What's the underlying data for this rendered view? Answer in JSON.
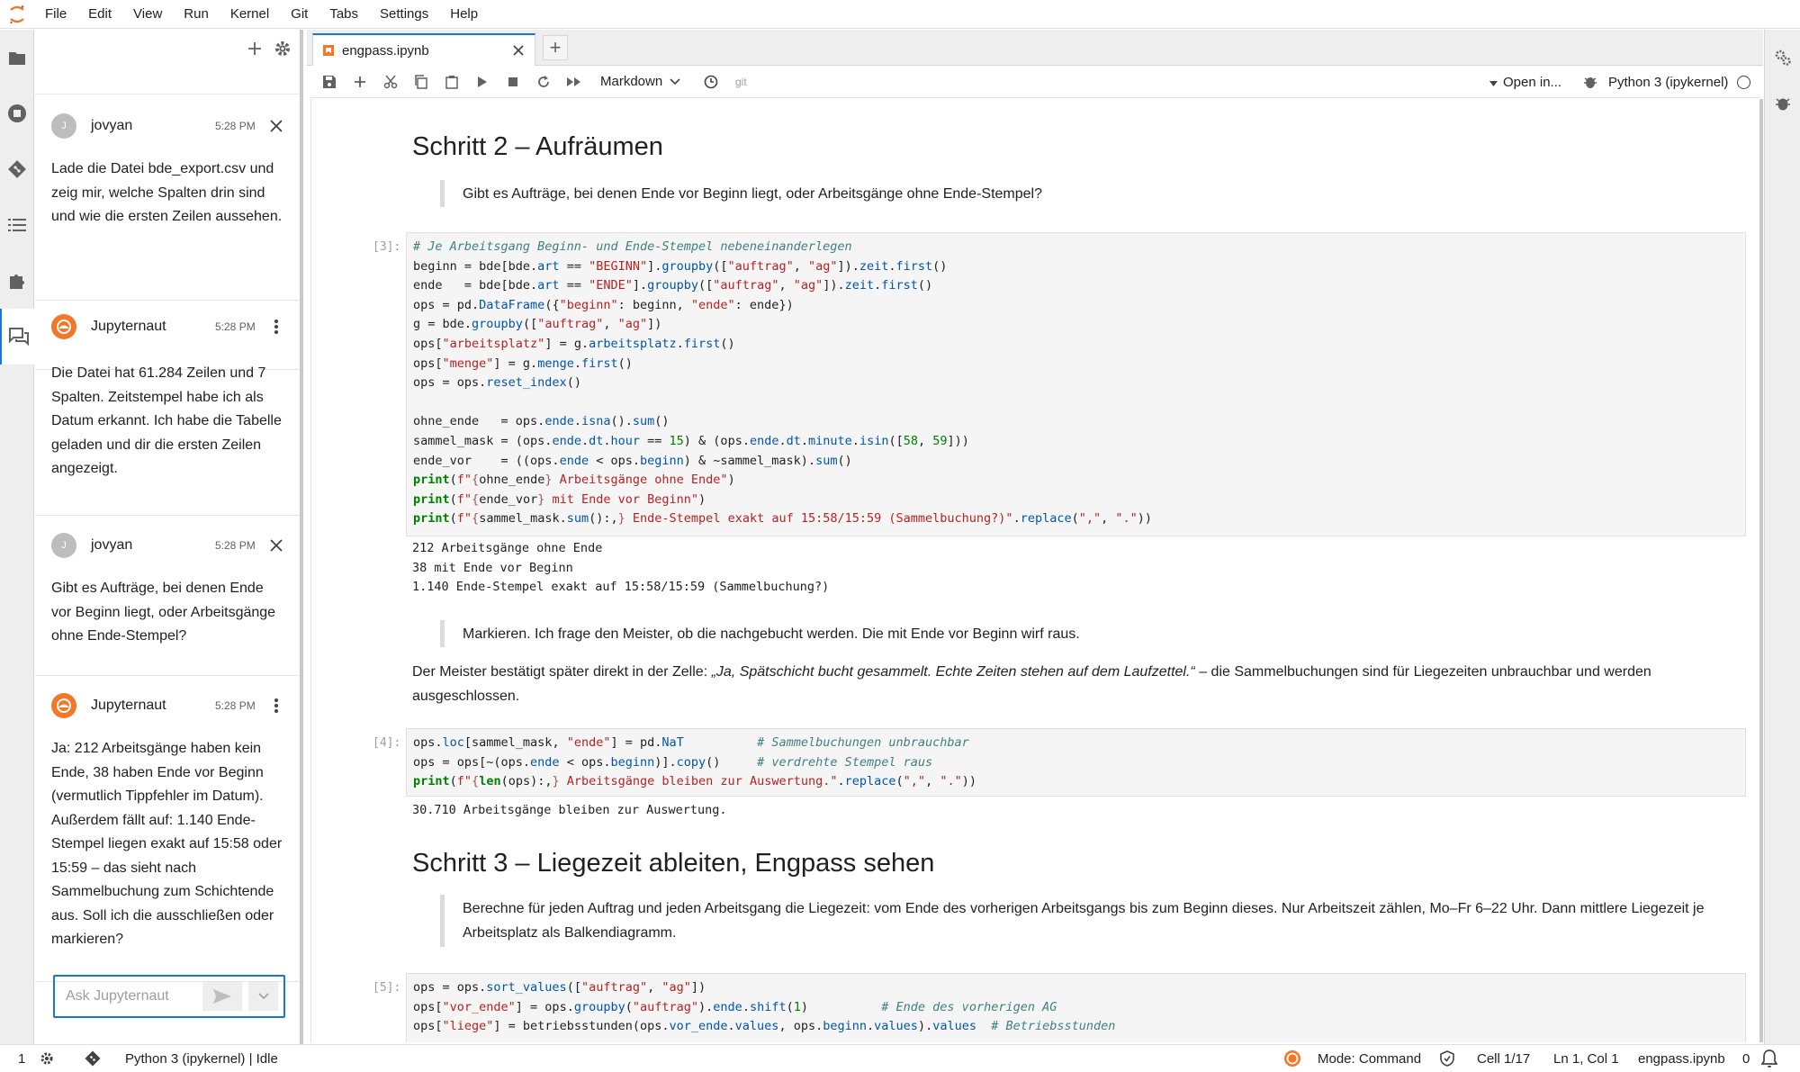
{
  "menu": [
    "File",
    "Edit",
    "View",
    "Run",
    "Kernel",
    "Git",
    "Tabs",
    "Settings",
    "Help"
  ],
  "chat": {
    "messages": [
      {
        "author": "jovyan",
        "avatar": "J",
        "time": "5:28 PM",
        "text": "Lade die Datei bde_export.csv und zeig mir, welche Spalten drin sind und wie die ersten Zeilen aussehen."
      },
      {
        "author": "Jupyternaut",
        "avatar": "",
        "time": "5:28 PM",
        "text": "Die Datei hat 61.284 Zeilen und 7 Spalten. Zeitstempel habe ich als Datum erkannt. Ich habe die Tabelle geladen und dir die ersten Zeilen angezeigt."
      },
      {
        "author": "jovyan",
        "avatar": "J",
        "time": "5:28 PM",
        "text": "Gibt es Aufträge, bei denen Ende vor Beginn liegt, oder Arbeitsgänge ohne Ende-Stempel?"
      },
      {
        "author": "Jupyternaut",
        "avatar": "",
        "time": "5:28 PM",
        "text": "Ja: 212 Arbeitsgänge haben kein Ende, 38 haben Ende vor Beginn (vermutlich Tippfehler im Datum). Außerdem fällt auf: 1.140 Ende-Stempel liegen exakt auf 15:58 oder 15:59 – das sieht nach Sammelbuchung zum Schichtende aus. Soll ich die ausschließen oder markieren?"
      }
    ],
    "input_placeholder": "Ask Jupyternaut"
  },
  "tab": {
    "label": "engpass.ipynb"
  },
  "toolbar": {
    "cell_type": "Markdown",
    "git": "git",
    "open_in": "Open in...",
    "kernel": "Python 3 (ipykernel)"
  },
  "notebook": {
    "h_schritt2": "Schritt 2 – Aufräumen",
    "q1": "Gibt es Aufträge, bei denen Ende vor Beginn liegt, oder Arbeitsgänge ohne Ende-Stempel?",
    "prompt3": "[3]:",
    "out3": [
      "212 Arbeitsgänge ohne Ende",
      "38 mit Ende vor Beginn",
      "1.140 Ende-Stempel exakt auf 15:58/15:59 (Sammelbuchung?)"
    ],
    "q2": "Markieren. Ich frage den Meister, ob die nachgebucht werden. Die mit Ende vor Beginn wirf raus.",
    "p1_pre": "Der Meister bestätigt später direkt in der Zelle: ",
    "p1_em": "„Ja, Spätschicht bucht gesammelt. Echte Zeiten stehen auf dem Laufzettel.“",
    "p1_post": " – die Sammelbuchungen sind für Liegezeiten unbrauchbar und werden ausgeschlossen.",
    "prompt4": "[4]:",
    "out4": "30.710 Arbeitsgänge bleiben zur Auswertung.",
    "h_schritt3": "Schritt 3 – Liegezeit ableiten, Engpass sehen",
    "q3": "Berechne für jeden Auftrag und jeden Arbeitsgang die Liegezeit: vom Ende des vorherigen Arbeitsgangs bis zum Beginn dieses. Nur Arbeitszeit zählen, Mo–Fr 6–22 Uhr. Dann mittlere Liegezeit je Arbeitsplatz als Balkendiagramm.",
    "prompt5": "[5]:"
  },
  "status": {
    "terminals": "1",
    "kernel_status": "Python 3 (ipykernel) | Idle",
    "mode": "Mode: Command",
    "cell": "Cell 1/17",
    "position": "Ln 1, Col 1",
    "file": "engpass.ipynb",
    "notifications": "0"
  }
}
